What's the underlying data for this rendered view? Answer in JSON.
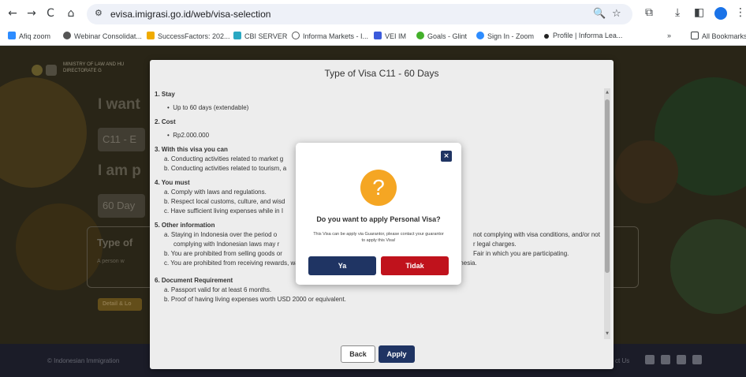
{
  "browser": {
    "url": "evisa.imigrasi.go.id/web/visa-selection",
    "icons": {
      "back": "←",
      "forward": "→",
      "reload": "C",
      "home": "⌂",
      "site_info": "⚙",
      "zoom": "🔍",
      "star": "☆",
      "extensions": "⧉",
      "download": "⤓",
      "sidebar": "◧",
      "menu": "⋮"
    }
  },
  "bookmarks": [
    {
      "label": "Afiq zoom",
      "color": "#2d8cff"
    },
    {
      "label": "Webinar Consolidat...",
      "color": "#555555"
    },
    {
      "label": "SuccessFactors: 202...",
      "color": "#f0ab00"
    },
    {
      "label": "CBI SERVER",
      "color": "#2aa8c2"
    },
    {
      "label": "Informa Markets - I...",
      "color": "#555555"
    },
    {
      "label": "VEI IM",
      "color": "#3b5bdb"
    },
    {
      "label": "Goals - Glint",
      "color": "#43b02a"
    },
    {
      "label": "Sign In - Zoom",
      "color": "#2d8cff"
    },
    {
      "label": "Profile | Informa Lea...",
      "color": "#222222"
    }
  ],
  "bookmarks_more": "»",
  "bookmarks_all": "All Bookmarks",
  "background_page": {
    "ministry_line1": "MINISTRY OF LAW AND HU",
    "ministry_line2": "DIRECTORATE G",
    "heading_want": "I want",
    "select_visa": "C11 - E",
    "heading_purpose": "I am p",
    "select_days": "60 Day",
    "card_title": "Type of",
    "card_text": "A person w",
    "detail_button": "Detail & Lo",
    "footer_copy": "© Indonesian Immigration",
    "footer_contact": "ct Us"
  },
  "visa_modal": {
    "title": "Type of Visa C11 - 60 Days",
    "sections": {
      "stay_title": "1. Stay",
      "stay_item": "Up to 60 days (extendable)",
      "cost_title": "2. Cost",
      "cost_item": "Rp2.000.000",
      "can_title": "3. With this visa you can",
      "can_a": "a. Conducting activities related to market g",
      "can_b": "b. Conducting activities related to tourism, a",
      "must_title": "4. You must",
      "must_a": "a. Comply with laws and regulations.",
      "must_b": "b. Respect local customs, culture, and wisd",
      "must_c": "c. Have sufficient living expenses while in I",
      "other_title": "5. Other information",
      "other_a1": "a. Staying in Indonesia over the period o",
      "other_a1_right": "not complying with visa conditions, and/or not",
      "other_a2": "complying with Indonesian laws may r",
      "other_a2_right": "r legal charges.",
      "other_b": "b. You are prohibited from selling goods or",
      "other_b_right": "Fair in which you are participating.",
      "other_c": "c. You are prohibited from receiving rewards, wages, or any similar from individuals or corporations in Indonesia.",
      "doc_title": "6. Document Requirement",
      "doc_a": "a. Passport valid for at least 6 months.",
      "doc_b": "b. Proof of having living expenses worth USD 2000 or equivalent."
    },
    "back_label": "Back",
    "apply_label": "Apply"
  },
  "confirm_dialog": {
    "close": "×",
    "icon": "?",
    "title": "Do you want to apply Personal Visa?",
    "text": "This Visa can be apply via Guarantor, please contact your guarantor to apply this Visa!",
    "yes_label": "Ya",
    "no_label": "Tidak"
  }
}
